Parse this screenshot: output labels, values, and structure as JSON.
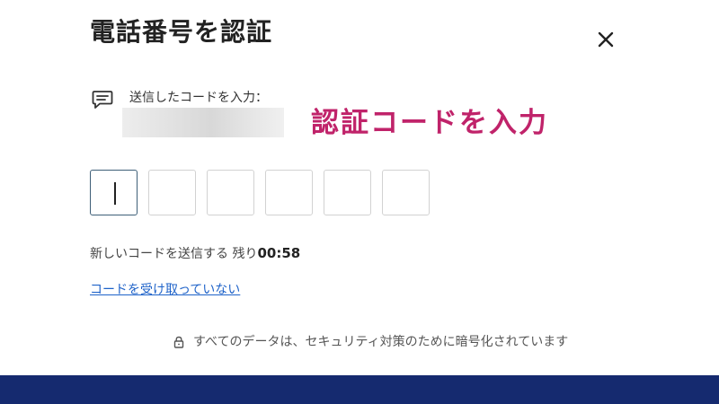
{
  "dialog": {
    "title": "電話番号を認証",
    "sent_label": "送信したコードを入力：",
    "annotation": "認証コードを入力",
    "code_digits": [
      "",
      "",
      "",
      "",
      "",
      ""
    ],
    "resend_label": "新しいコードを送信する",
    "remaining_prefix": "残り",
    "remaining_time": "00:58",
    "not_received_link": "コードを受け取っていない",
    "security_note": "すべてのデータは、セキュリティ対策のために暗号化されています"
  },
  "icons": {
    "close": "close-icon",
    "message": "message-icon",
    "lock": "lock-icon"
  },
  "colors": {
    "annotation": "#c0236a",
    "link": "#1f63c9",
    "active_box_border": "#3e5f78",
    "footer": "#152a6f"
  }
}
